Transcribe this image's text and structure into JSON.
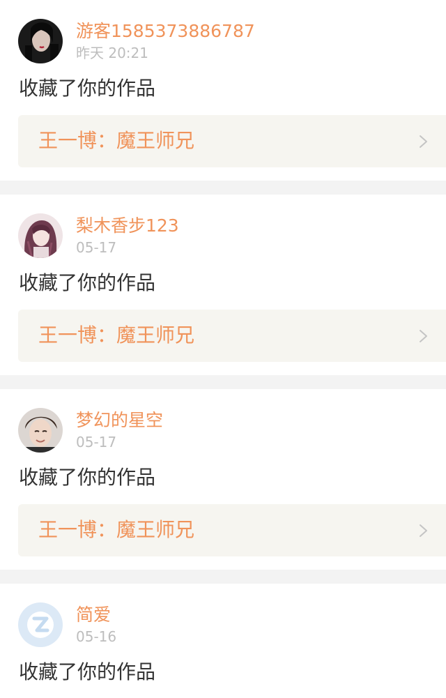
{
  "notifications": [
    {
      "username": "游客1585373886787",
      "time": "昨天 20:21",
      "action": "收藏了你的作品",
      "work_title": "王一博：魔王师兄",
      "avatar_icon": "user-avatar-photo"
    },
    {
      "username": "梨木香步123",
      "time": "05-17",
      "action": "收藏了你的作品",
      "work_title": "王一博：魔王师兄",
      "avatar_icon": "user-avatar-anime"
    },
    {
      "username": "梦幻的星空",
      "time": "05-17",
      "action": "收藏了你的作品",
      "work_title": "王一博：魔王师兄",
      "avatar_icon": "user-avatar-photo"
    },
    {
      "username": "简爱",
      "time": "05-16",
      "action": "收藏了你的作品",
      "avatar_icon": "default-avatar-icon"
    }
  ],
  "colors": {
    "accent": "#f0935a",
    "timestamp": "#bdbdbd",
    "body_text": "#333333",
    "link_background": "#f6f5f0",
    "page_background": "#f3f3f3"
  }
}
